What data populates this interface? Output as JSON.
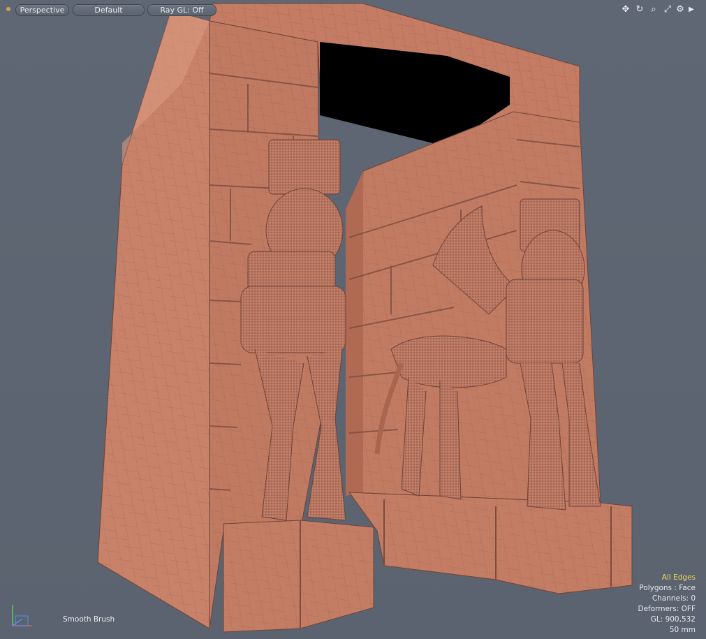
{
  "header": {
    "view_type": "Perspective",
    "shading": "Default",
    "ray_gl": "Ray GL: Off"
  },
  "toolbar_icons": [
    "move-icon",
    "rotate-icon",
    "zoom-icon",
    "maximize-icon",
    "settings-icon",
    "expand-arrow-icon"
  ],
  "hud": {
    "edges": "All Edges",
    "polygons": "Polygons : Face",
    "channels": "Channels: 0",
    "deformers": "Deformers: OFF",
    "gl": "GL: 900,532",
    "lens": "50 mm"
  },
  "tool": {
    "active_brush": "Smooth Brush"
  },
  "colors": {
    "viewport_bg": "#5d6572",
    "model": "#c8836a",
    "model_dark": "#a86650",
    "highlight_text": "#f2d85c"
  }
}
